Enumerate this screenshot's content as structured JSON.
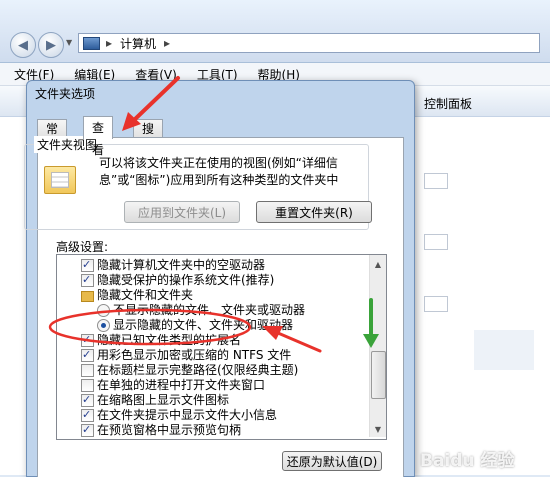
{
  "explorer": {
    "address_path": "计算机",
    "menu": [
      "文件(F)",
      "编辑(E)",
      "查看(V)",
      "工具(T)",
      "帮助(H)"
    ],
    "right_label": "控制面板"
  },
  "dialog": {
    "title": "文件夹选项",
    "tabs": [
      "常规",
      "查看",
      "搜索"
    ],
    "folder_views": {
      "legend": "文件夹视图",
      "line1": "可以将该文件夹正在使用的视图(例如“详细信",
      "line2": "息”或“图标”)应用到所有这种类型的文件夹中",
      "apply_button": "应用到文件夹(L)",
      "reset_button": "重置文件夹(R)"
    },
    "advanced_label": "高级设置:",
    "tree": [
      {
        "kind": "checkbox",
        "checked": true,
        "indent": 0,
        "label": "隐藏计算机文件夹中的空驱动器"
      },
      {
        "kind": "checkbox",
        "checked": true,
        "indent": 0,
        "label": "隐藏受保护的操作系统文件(推荐)"
      },
      {
        "kind": "folder",
        "checked": false,
        "indent": 0,
        "label": "隐藏文件和文件夹"
      },
      {
        "kind": "radio",
        "checked": false,
        "indent": 1,
        "label": "不显示隐藏的文件、文件夹或驱动器"
      },
      {
        "kind": "radio",
        "checked": true,
        "indent": 1,
        "label": "显示隐藏的文件、文件夹和驱动器"
      },
      {
        "kind": "checkbox",
        "checked": true,
        "indent": 0,
        "label": "隐藏已知文件类型的扩展名"
      },
      {
        "kind": "checkbox",
        "checked": true,
        "indent": 0,
        "label": "用彩色显示加密或压缩的 NTFS 文件"
      },
      {
        "kind": "checkbox",
        "checked": false,
        "indent": 0,
        "label": "在标题栏显示完整路径(仅限经典主题)"
      },
      {
        "kind": "checkbox",
        "checked": false,
        "indent": 0,
        "label": "在单独的进程中打开文件夹窗口"
      },
      {
        "kind": "checkbox",
        "checked": true,
        "indent": 0,
        "label": "在缩略图上显示文件图标"
      },
      {
        "kind": "checkbox",
        "checked": true,
        "indent": 0,
        "label": "在文件夹提示中显示文件大小信息"
      },
      {
        "kind": "checkbox",
        "checked": true,
        "indent": 0,
        "label": "在预览窗格中显示预览句柄"
      }
    ],
    "restore_button": "还原为默认值(D)"
  },
  "annotations": {
    "colors": {
      "red": "#e8322b",
      "green": "#3aa33a"
    }
  },
  "watermark": "Baidu 经验"
}
